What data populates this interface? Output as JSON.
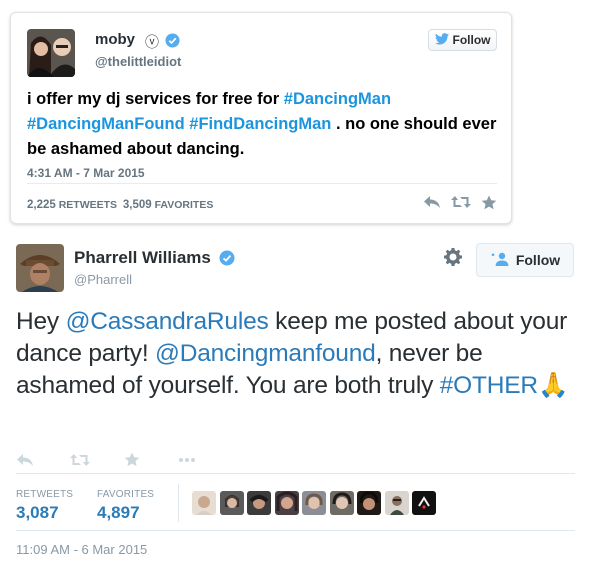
{
  "moby_tweet": {
    "name": "moby",
    "name_symbol": "ⓥ",
    "handle": "@thelittleidiot",
    "follow_label": "Follow",
    "text_segments": [
      {
        "text": "i offer my dj services for free for ",
        "hashtag": false
      },
      {
        "text": "#DancingMan",
        "hashtag": true
      },
      {
        "text": " ",
        "hashtag": false
      },
      {
        "text": "#DancingManFound",
        "hashtag": true
      },
      {
        "text": " ",
        "hashtag": false
      },
      {
        "text": "#FindDancingMan",
        "hashtag": true
      },
      {
        "text": " . no one should ever be ashamed about dancing.",
        "hashtag": false
      }
    ],
    "timestamp": "4:31 AM - 7 Mar 2015",
    "retweets_count": "2,225",
    "retweets_label": "RETWEETS",
    "favorites_count": "3,509",
    "favorites_label": "FAVORITES"
  },
  "pharrell_tweet": {
    "name": "Pharrell Williams",
    "handle": "@Pharrell",
    "follow_label": "Follow",
    "text_segments": [
      {
        "text": "Hey ",
        "link": false
      },
      {
        "text": "@CassandraRules",
        "link": true
      },
      {
        "text": " keep me posted about your dance party! ",
        "link": false
      },
      {
        "text": "@Dancingmanfound",
        "link": true
      },
      {
        "text": ", never be ashamed of yourself. You are both truly ",
        "link": false
      },
      {
        "text": "#OTHER",
        "link": true
      },
      {
        "text": "🙏",
        "link": false
      }
    ],
    "retweets_label": "RETWEETS",
    "retweets_count": "3,087",
    "favorites_label": "FAVORITES",
    "favorites_count": "4,897",
    "timestamp": "11:09 AM - 6 Mar 2015"
  },
  "colors": {
    "link_blue": "#2b7bb9",
    "hashtag_blue": "#1b95e0",
    "verified_blue": "#55acee",
    "muted_gray": "#8899a6"
  },
  "icons": {
    "verified": "verified-badge-icon",
    "twitter_bird": "twitter-bird-icon",
    "reply": "reply-icon",
    "retweet": "retweet-icon",
    "favorite": "star-icon",
    "more": "more-dots-icon",
    "gear": "gear-icon",
    "follow_person": "add-person-icon"
  }
}
